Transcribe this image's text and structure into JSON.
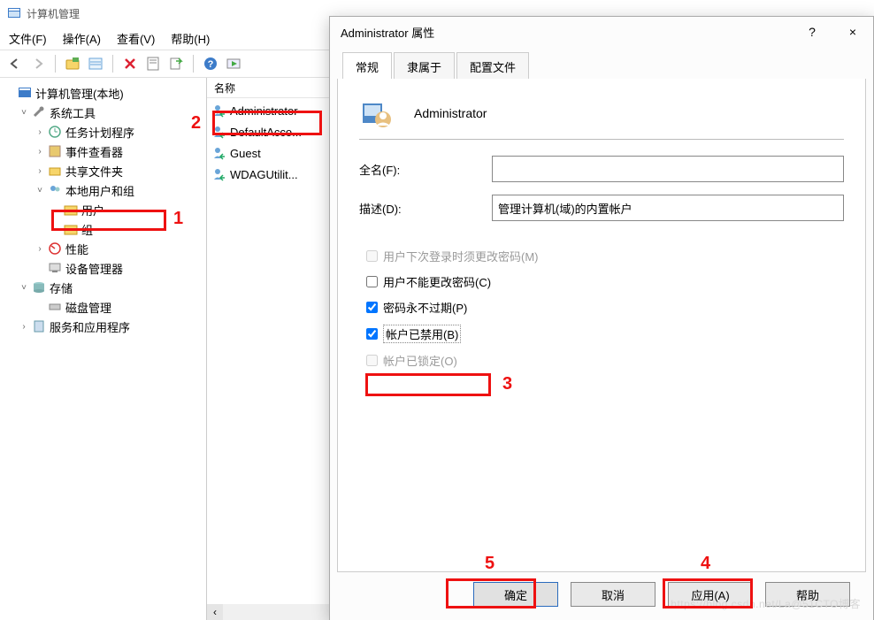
{
  "main": {
    "title": "计算机管理",
    "menus": {
      "file": "文件(F)",
      "action": "操作(A)",
      "view": "查看(V)",
      "help": "帮助(H)"
    },
    "list_header_name": "名称"
  },
  "tree": {
    "root": "计算机管理(本地)",
    "system_tools": "系统工具",
    "task_scheduler": "任务计划程序",
    "event_viewer": "事件查看器",
    "shared_folders": "共享文件夹",
    "local_users_groups": "本地用户和组",
    "users": "用户",
    "groups": "组",
    "performance": "性能",
    "device_manager": "设备管理器",
    "storage": "存储",
    "disk_management": "磁盘管理",
    "services_apps": "服务和应用程序"
  },
  "users_list": {
    "u0": "Administrator",
    "u1": "DefaultAcco...",
    "u2": "Guest",
    "u3": "WDAGUtilit..."
  },
  "dialog": {
    "title": "Administrator 属性",
    "help": "?",
    "close": "×",
    "tabs": {
      "general": "常规",
      "memberof": "隶属于",
      "profile": "配置文件"
    },
    "user_name": "Administrator",
    "lbl_fullname": "全名(F):",
    "lbl_desc": "描述(D):",
    "val_fullname": "",
    "val_desc": "管理计算机(域)的内置帐户",
    "chk_change_next": "用户下次登录时须更改密码(M)",
    "chk_cannot_change": "用户不能更改密码(C)",
    "chk_never_expire": "密码永不过期(P)",
    "chk_disabled": "帐户已禁用(B)",
    "chk_locked": "帐户已锁定(O)",
    "btn_ok": "确定",
    "btn_cancel": "取消",
    "btn_apply": "应用(A)",
    "btn_help": "帮助"
  },
  "annotations": {
    "a1": "1",
    "a2": "2",
    "a3": "3",
    "a4": "4",
    "a5": "5"
  },
  "watermark": "https://blog.csdn.net/La@51CTO博客"
}
